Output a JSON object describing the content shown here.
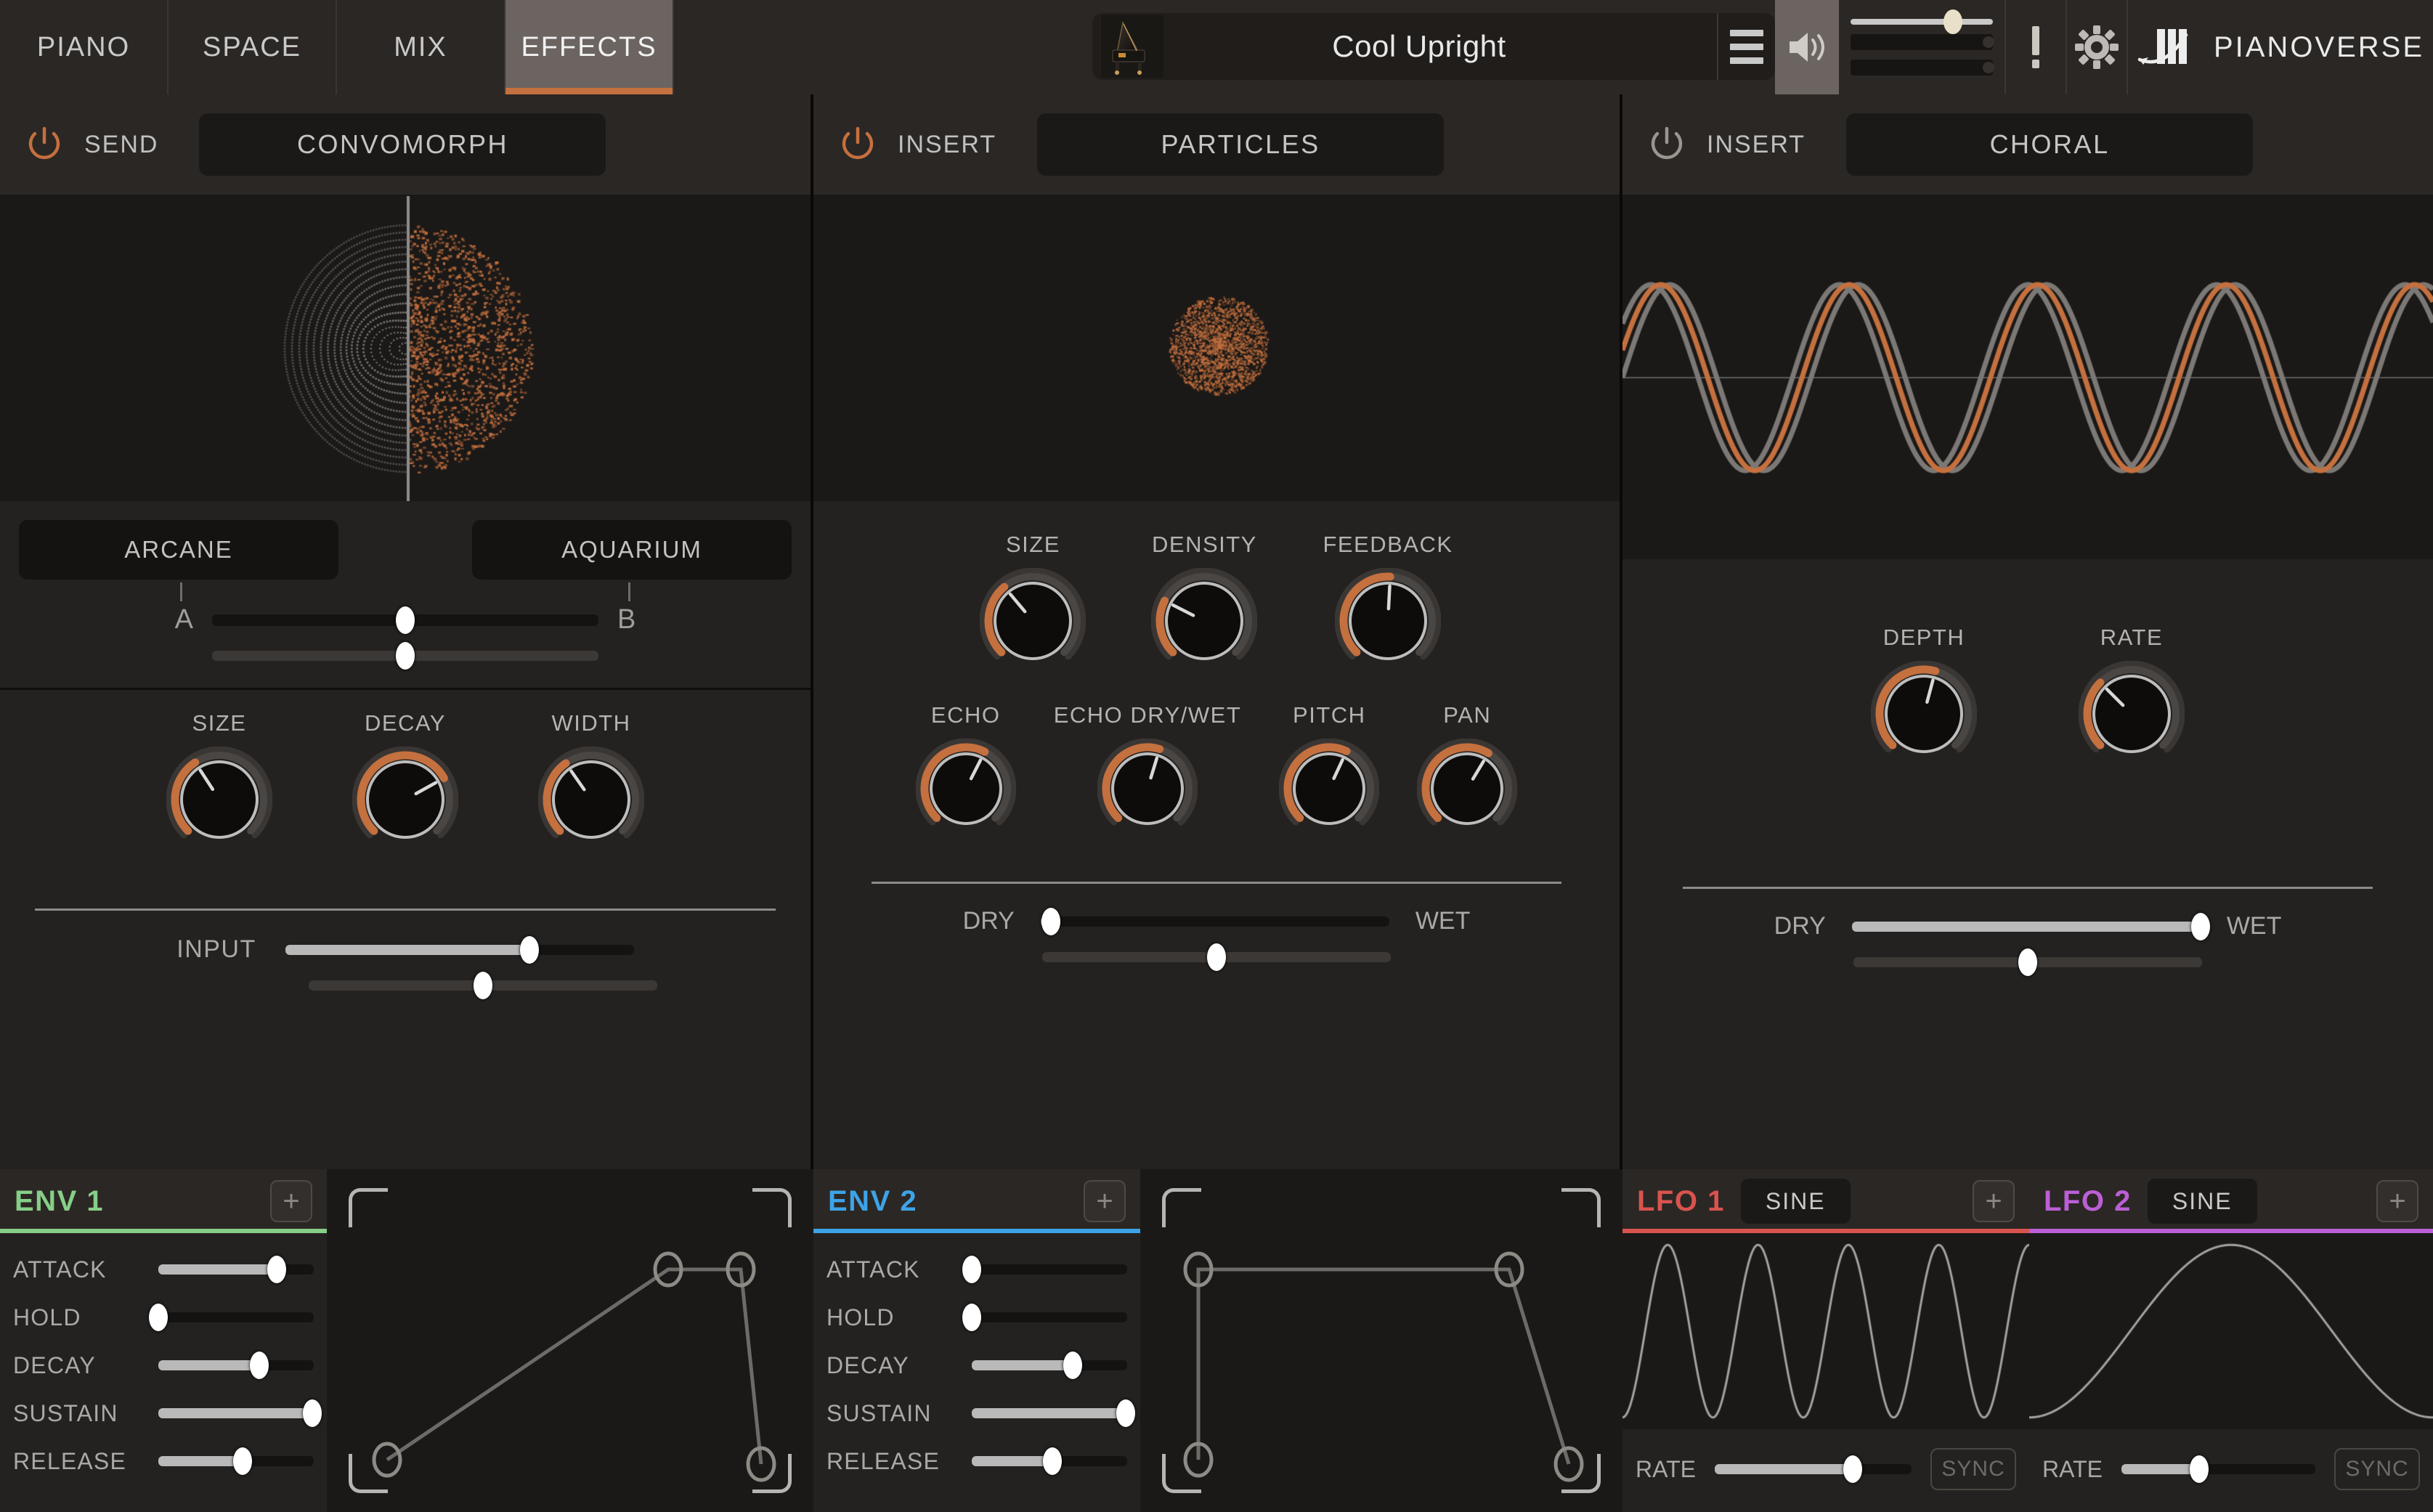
{
  "app": {
    "brand": "PIANOVERSE",
    "accent_orange": "#c4703f",
    "panel_bg": "#242220",
    "viz_bg": "#1b1917"
  },
  "topbar": {
    "tabs": [
      {
        "label": "PIANO",
        "active": false
      },
      {
        "label": "SPACE",
        "active": false
      },
      {
        "label": "MIX",
        "active": false
      },
      {
        "label": "EFFECTS",
        "active": true
      }
    ],
    "preset": {
      "name": "Cool Upright",
      "thumbnail_icon": "upright-piano-thumbnail",
      "menu_icon": "hamburger-menu-icon"
    },
    "speaker_icon": "speaker-volume-icon",
    "volume": {
      "value_pct": 72,
      "mod1_pct": 97,
      "mod2_pct": 97
    },
    "alert_icon": "exclamation-icon",
    "settings_icon": "gear-icon",
    "logo_icon": "pianoverse-keys-logo"
  },
  "effects": [
    {
      "id": "convomorph",
      "power_on": true,
      "power_icon": "power-icon",
      "slot_mode": "SEND",
      "name": "CONVOMORPH",
      "visualizer": "convomorph-split-particle-field",
      "morph": {
        "a_button": "ARCANE",
        "b_button": "AQUARIUM",
        "a_label": "A",
        "b_label": "B",
        "morph_pct": 50,
        "mod_pct": 50
      },
      "knobs": [
        {
          "label": "SIZE",
          "value_pct": 50,
          "arc_deg": 102
        },
        {
          "label": "DECAY",
          "value_pct": 78,
          "arc_deg": 196
        },
        {
          "label": "WIDTH",
          "value_pct": 50,
          "arc_deg": 100
        }
      ],
      "level": {
        "label": "INPUT",
        "value_pct": 70,
        "mod_pct": 50
      }
    },
    {
      "id": "particles",
      "power_on": true,
      "power_icon": "power-icon",
      "slot_mode": "INSERT",
      "name": "PARTICLES",
      "visualizer": "particle-cloud",
      "knobs_row1": [
        {
          "label": "SIZE",
          "value_pct": 32,
          "arc_deg": 95
        },
        {
          "label": "DENSITY",
          "value_pct": 23,
          "arc_deg": 72
        },
        {
          "label": "FEEDBACK",
          "value_pct": 48,
          "arc_deg": 138
        }
      ],
      "knobs_row2": [
        {
          "label": "ECHO",
          "value_pct": 60,
          "arc_deg": 162
        },
        {
          "label": "ECHO DRY/WET",
          "value_pct": 53,
          "arc_deg": 152
        },
        {
          "label": "PITCH",
          "value_pct": 58,
          "arc_deg": 160
        },
        {
          "label": "PAN",
          "value_pct": 62,
          "arc_deg": 166
        }
      ],
      "mix": {
        "dry_label": "DRY",
        "wet_label": "WET",
        "value_pct": 3,
        "mod_pct": 50
      }
    },
    {
      "id": "choral",
      "power_on": false,
      "power_icon": "power-icon",
      "slot_mode": "INSERT",
      "name": "CHORAL",
      "visualizer": "triple-phase-sine-waves",
      "knobs": [
        {
          "label": "DEPTH",
          "value_pct": 56,
          "arc_deg": 150
        },
        {
          "label": "RATE",
          "value_pct": 28,
          "arc_deg": 90
        }
      ],
      "mix": {
        "dry_label": "DRY",
        "wet_label": "WET",
        "value_pct": 100,
        "mod_pct": 50
      }
    }
  ],
  "modulators": [
    {
      "id": "env1",
      "title": "ENV 1",
      "accent": "#87cf87",
      "add_icon": "plus-icon",
      "rows": [
        {
          "label": "ATTACK",
          "value_pct": 76
        },
        {
          "label": "HOLD",
          "value_pct": 0
        },
        {
          "label": "DECAY",
          "value_pct": 65
        },
        {
          "label": "SUSTAIN",
          "value_pct": 99
        },
        {
          "label": "RELEASE",
          "value_pct": 54
        }
      ],
      "curve": "adsr-attack-ramp"
    },
    {
      "id": "env2",
      "title": "ENV 2",
      "accent": "#3da3e8",
      "add_icon": "plus-icon",
      "rows": [
        {
          "label": "ATTACK",
          "value_pct": 0
        },
        {
          "label": "HOLD",
          "value_pct": 0
        },
        {
          "label": "DECAY",
          "value_pct": 65
        },
        {
          "label": "SUSTAIN",
          "value_pct": 99
        },
        {
          "label": "RELEASE",
          "value_pct": 52
        }
      ],
      "curve": "adsr-instant-attack"
    },
    {
      "id": "lfo1",
      "title": "LFO 1",
      "accent": "#d9534f",
      "waveform": "SINE",
      "add_icon": "plus-icon",
      "rate": {
        "label": "RATE",
        "value_pct": 70
      },
      "sync_label": "SYNC",
      "sync_on": false,
      "cycles": 4.5
    },
    {
      "id": "lfo2",
      "title": "LFO 2",
      "accent": "#bb5fd6",
      "waveform": "SINE",
      "add_icon": "plus-icon",
      "rate": {
        "label": "RATE",
        "value_pct": 40
      },
      "sync_label": "SYNC",
      "sync_on": false,
      "cycles": 1.0
    }
  ]
}
